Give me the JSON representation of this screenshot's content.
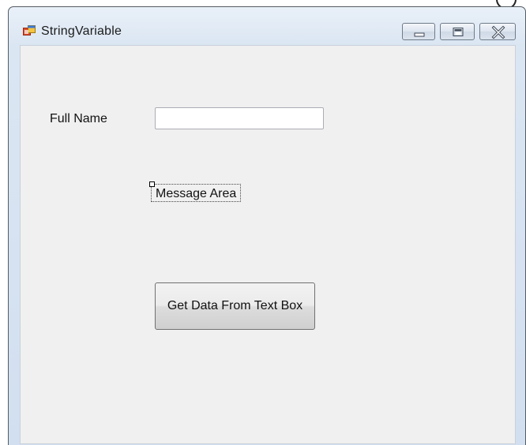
{
  "window": {
    "title": "StringVariable",
    "caption_buttons": [
      "minimize-icon",
      "maximize-icon",
      "close-icon"
    ]
  },
  "form": {
    "full_name_label": "Full Name",
    "full_name_value": "",
    "message_label": "Message Area",
    "get_data_button": "Get Data From Text Box"
  }
}
